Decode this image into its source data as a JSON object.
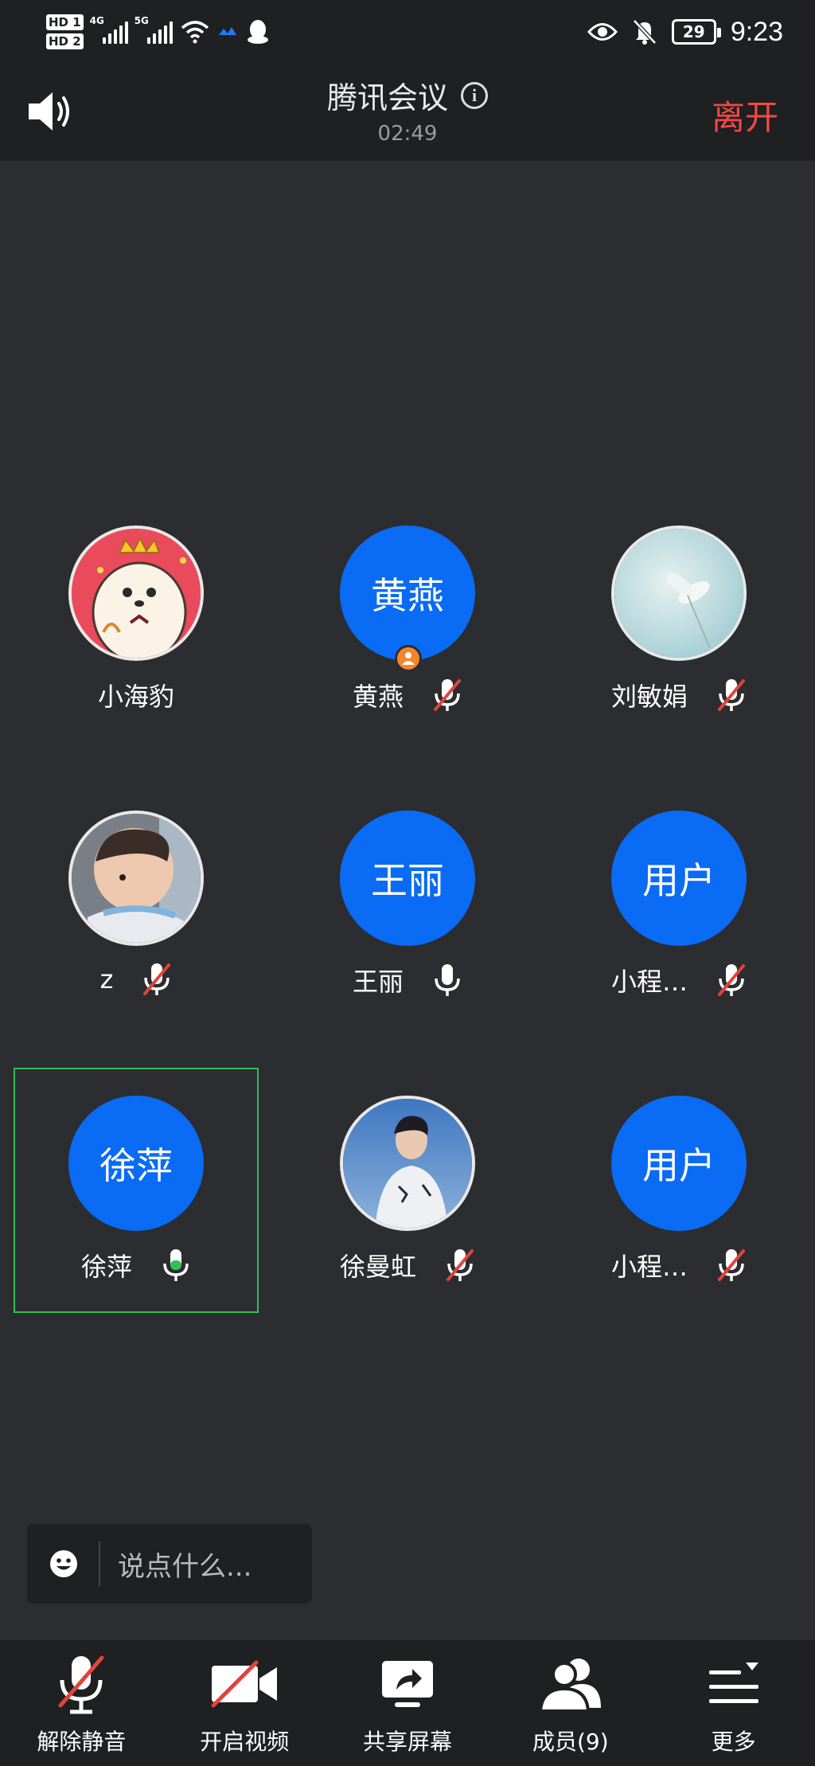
{
  "status_bar": {
    "sim1": "HD 1",
    "sim2": "HD 2",
    "net1": "4G",
    "net2": "5G",
    "battery": "29",
    "time": "9:23"
  },
  "header": {
    "title": "腾讯会议",
    "timer": "02:49",
    "leave_label": "离开"
  },
  "participants": [
    {
      "name": "小海豹",
      "avatar_text": "",
      "avatar_type": "photo",
      "mic": "none"
    },
    {
      "name": "黄燕",
      "avatar_text": "黄燕",
      "avatar_type": "initials",
      "mic": "muted",
      "host": true
    },
    {
      "name": "刘敏娟",
      "avatar_text": "",
      "avatar_type": "photo",
      "mic": "muted"
    },
    {
      "name": "z",
      "avatar_text": "",
      "avatar_type": "photo",
      "mic": "muted"
    },
    {
      "name": "王丽",
      "avatar_text": "王丽",
      "avatar_type": "initials",
      "mic": "on"
    },
    {
      "name": "小程…",
      "avatar_text": "用户",
      "avatar_type": "initials",
      "mic": "muted"
    },
    {
      "name": "徐萍",
      "avatar_text": "徐萍",
      "avatar_type": "initials",
      "mic": "speaking",
      "selected": true
    },
    {
      "name": "徐曼虹",
      "avatar_text": "",
      "avatar_type": "photo",
      "mic": "muted"
    },
    {
      "name": "小程…",
      "avatar_text": "用户",
      "avatar_type": "initials",
      "mic": "muted"
    }
  ],
  "chat": {
    "placeholder": "说点什么..."
  },
  "toolbar": {
    "unmute_label": "解除静音",
    "video_label": "开启视频",
    "share_label": "共享屏幕",
    "members_label": "成员(9)",
    "more_label": "更多"
  },
  "colors": {
    "background": "#2c2d30",
    "bar": "#1f2022",
    "avatar_blue": "#0a6bf5",
    "leave_red": "#f24a44",
    "muted_red": "#e0443c",
    "speaking_green": "#2fbf52",
    "host_orange": "#f5852a"
  }
}
